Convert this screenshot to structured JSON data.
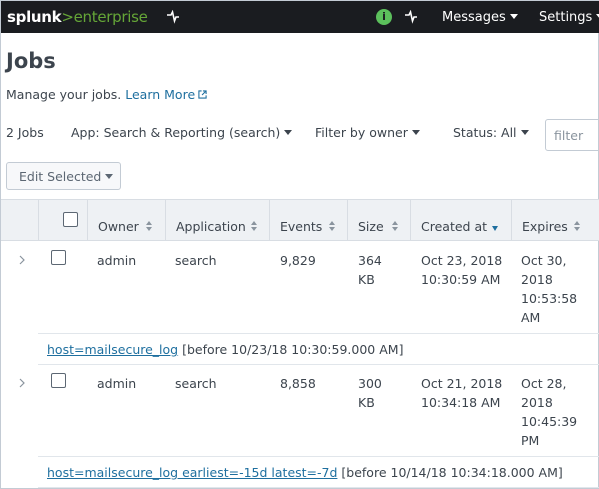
{
  "topbar": {
    "logo_main": "splunk",
    "logo_sub": ">enterprise",
    "activity_icon": "activity-icon",
    "health_status_color": "#5cc05c",
    "health_glyph": "i",
    "messages_label": "Messages",
    "settings_label": "Settings"
  },
  "page": {
    "title": "Jobs",
    "description": "Manage your jobs.",
    "learn_more": "Learn More"
  },
  "filters": {
    "count": "2 Jobs",
    "app": "App: Search & Reporting (search)",
    "owner": "Filter by owner",
    "status": "Status: All",
    "search_placeholder": "filter"
  },
  "actions": {
    "edit_selected": "Edit Selected"
  },
  "table": {
    "headers": [
      "Owner",
      "Application",
      "Events",
      "Size",
      "Created at",
      "Expires"
    ],
    "rows": [
      {
        "owner": "admin",
        "application": "search",
        "events": "9,829",
        "size_1": "364",
        "size_2": "KB",
        "created_1": "Oct 23, 2018",
        "created_2": "10:30:59 AM",
        "expires_1": "Oct 30,",
        "expires_2": "2018",
        "expires_3": "10:53:58",
        "expires_4": "AM",
        "search_query": "host=mailsecure_log",
        "search_meta": "[before 10/23/18 10:30:59.000 AM]"
      },
      {
        "owner": "admin",
        "application": "search",
        "events": "8,858",
        "size_1": "300",
        "size_2": "KB",
        "created_1": "Oct 21, 2018",
        "created_2": "10:34:18 AM",
        "expires_1": "Oct 28,",
        "expires_2": "2018",
        "expires_3": "10:45:39",
        "expires_4": "PM",
        "search_query": "host=mailsecure_log earliest=-15d latest=-7d",
        "search_meta": "[before 10/14/18 10:34:18.000 AM]"
      }
    ]
  },
  "colors": {
    "topbar_bg": "#1a1c20",
    "brand_green": "#65a637",
    "link_blue": "#1e6f9f"
  }
}
